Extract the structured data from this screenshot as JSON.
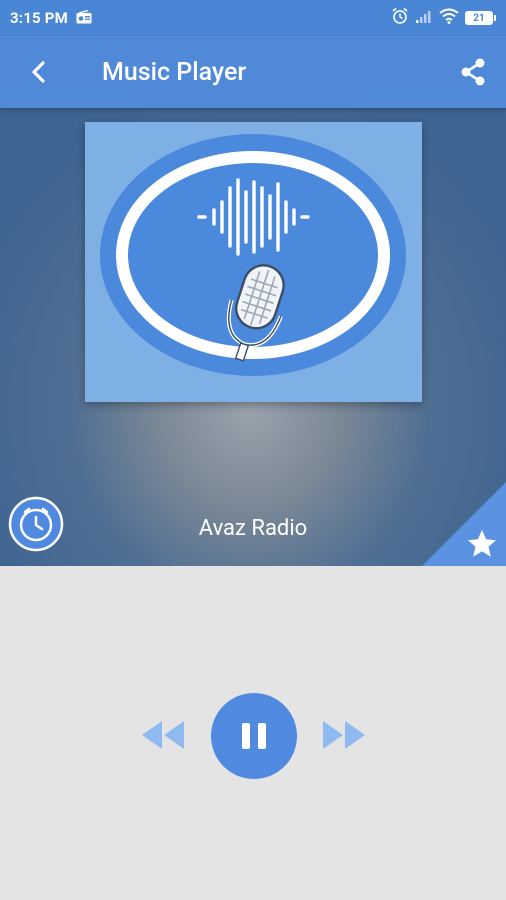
{
  "status_bar": {
    "time": "3:15 PM",
    "battery_level": "21",
    "icons": [
      "radio-icon",
      "alarm-icon",
      "signal-icon",
      "wifi-icon",
      "battery-icon"
    ]
  },
  "app_bar": {
    "title": "Music Player",
    "back_icon": "back-arrow-icon",
    "share_icon": "share-icon"
  },
  "player": {
    "station_name": "Avaz Radio",
    "artwork_icon": "microphone-soundwave-logo",
    "timer_icon": "clock-icon",
    "favorite_icon": "star-icon"
  },
  "controls": {
    "rewind_icon": "rewind-icon",
    "pause_icon": "pause-icon",
    "forward_icon": "fast-forward-icon"
  },
  "colors": {
    "primary": "#5089d8",
    "status_bar": "#4a86d6",
    "control_accent": "#4f8ae0",
    "control_light": "#8fbaf0",
    "background": "#e4e4e4"
  }
}
